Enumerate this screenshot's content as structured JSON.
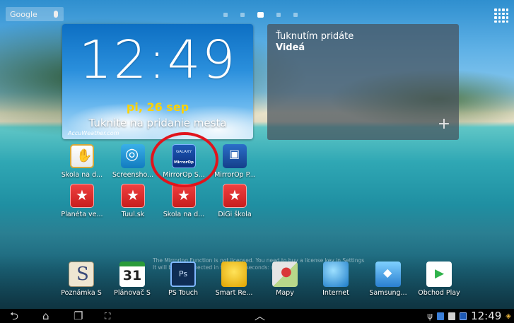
{
  "search": {
    "label": "Google"
  },
  "clock_widget": {
    "time": "12:49",
    "date": "pi, 26 sep",
    "city_prompt": "Tuknite na pridanie mesta",
    "brand": "AccuWeather.com"
  },
  "video_widget": {
    "hint": "Ťuknutím pridáte",
    "title": "Videá",
    "add_symbol": "+"
  },
  "home_icons": [
    {
      "label": "Škola na d..."
    },
    {
      "label": "Screensho..."
    },
    {
      "label": "MirrorOp S..."
    },
    {
      "label": "MirrorOp P..."
    },
    {
      "label": "Planéta ve..."
    },
    {
      "label": "Tuul.sk"
    },
    {
      "label": "Škola na d..."
    },
    {
      "label": "DiGi škola"
    }
  ],
  "mirror_icon_text": {
    "top": "GALAXY",
    "bottom": "MirrorOp"
  },
  "notice": {
    "line1": "The Mirroring Function is not licensed. You need to buy a license key in Settings.",
    "line2": "It will be disconnected in following seconds: (25)"
  },
  "dock": [
    {
      "label": "Poznámka S"
    },
    {
      "label": "Plánovač S",
      "icon_text": "31"
    },
    {
      "label": "PS Touch",
      "icon_text": "Ps"
    },
    {
      "label": "Smart Re..."
    },
    {
      "label": "Mapy"
    },
    {
      "label": "Internet"
    },
    {
      "label": "Samsung..."
    },
    {
      "label": "Obchod Play"
    }
  ],
  "status_bar": {
    "time": "12:49"
  },
  "colors": {
    "clock_date": "#ffd200",
    "annotation_ring": "#e0141c",
    "nav_bg": "#000000"
  }
}
